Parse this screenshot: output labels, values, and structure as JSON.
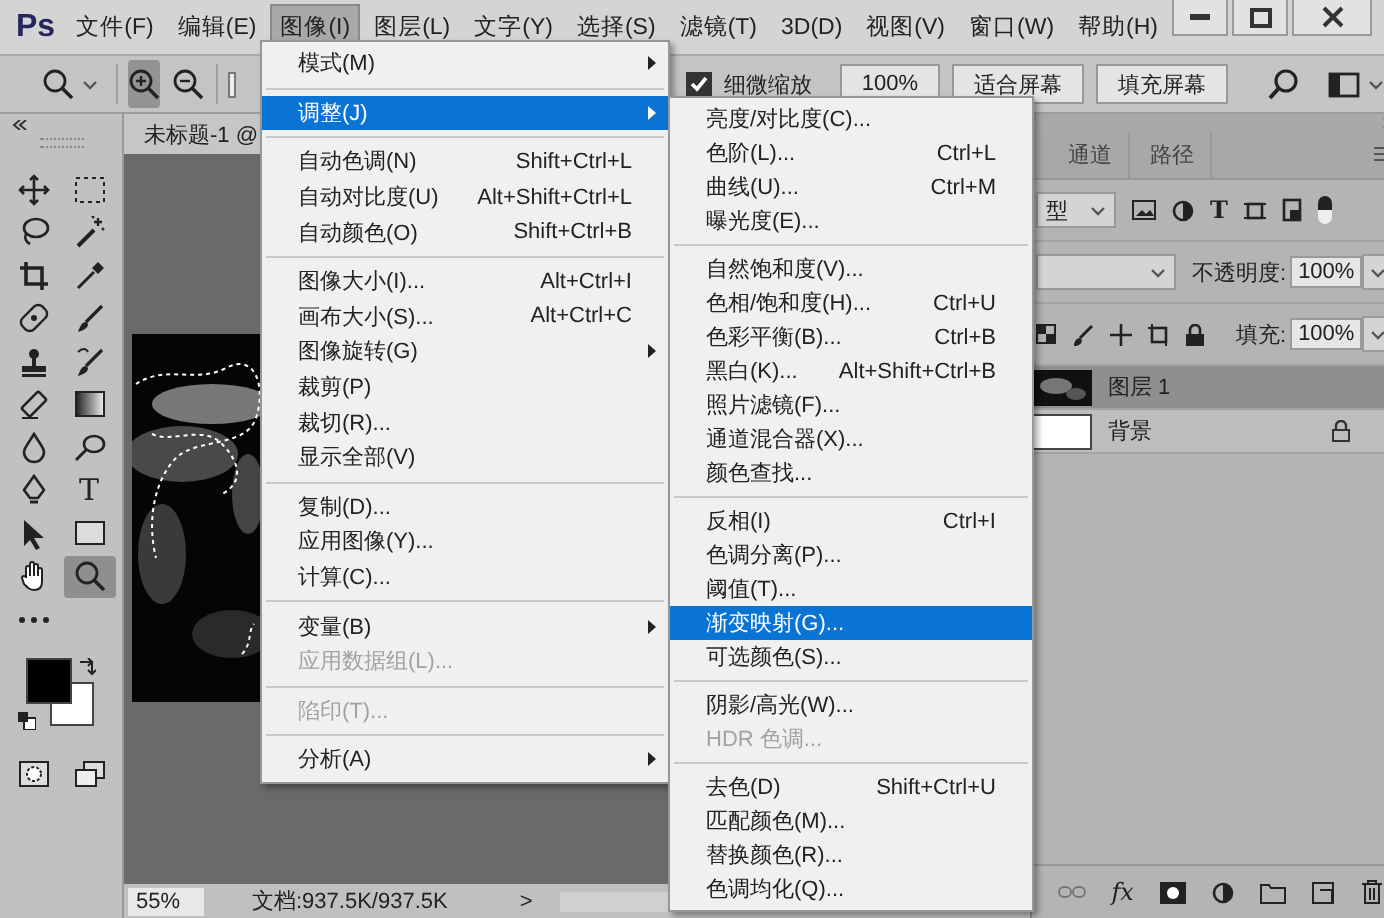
{
  "app": {
    "logo": "Ps"
  },
  "menu_bar": [
    {
      "label": "文件(F)",
      "selected": false
    },
    {
      "label": "编辑(E)",
      "selected": false
    },
    {
      "label": "图像(I)",
      "selected": true
    },
    {
      "label": "图层(L)",
      "selected": false
    },
    {
      "label": "文字(Y)",
      "selected": false
    },
    {
      "label": "选择(S)",
      "selected": false
    },
    {
      "label": "滤镜(T)",
      "selected": false
    },
    {
      "label": "3D(D)",
      "selected": false
    },
    {
      "label": "视图(V)",
      "selected": false
    },
    {
      "label": "窗口(W)",
      "selected": false
    },
    {
      "label": "帮助(H)",
      "selected": false
    }
  ],
  "options_bar": {
    "zoom_modes": [
      {
        "selected": true
      },
      {
        "selected": false
      }
    ],
    "resize_windows": {
      "checked": false
    },
    "fine_zoom": {
      "label": "细微缩放",
      "checked": true
    },
    "buttons": [
      "100%",
      "适合屏幕",
      "填充屏幕"
    ]
  },
  "document_tab": {
    "title": "未标题-1 @"
  },
  "tools": [
    {
      "selected": false
    },
    {
      "selected": false
    },
    {
      "selected": false
    },
    {
      "selected": false
    },
    {
      "selected": false
    },
    {
      "selected": false
    },
    {
      "selected": false
    },
    {
      "selected": false
    },
    {
      "selected": false
    },
    {
      "selected": false
    },
    {
      "selected": false
    },
    {
      "selected": false
    },
    {
      "selected": false
    },
    {
      "selected": false
    },
    {
      "selected": false
    },
    {
      "selected": false,
      "glyph": "T"
    },
    {
      "selected": false
    },
    {
      "selected": false
    },
    {
      "selected": false
    },
    {
      "selected": true
    },
    {
      "selected": false
    },
    {
      "selected": false
    },
    {
      "selected": false
    }
  ],
  "swatches": [
    {
      "color": "#000000"
    },
    {
      "color": "#ffffff"
    }
  ],
  "status_bar": {
    "zoom": "55%",
    "document": "文档:937.5K/937.5K",
    "arrow": ">"
  },
  "layers_panel": {
    "tabs": [
      {
        "label": "通道",
        "selected": false
      },
      {
        "label": "路径",
        "selected": false
      }
    ],
    "filter": "型",
    "filter_type_glyph": "T",
    "opacity_label": "不透明度:",
    "opacity": "100%",
    "fill_label": "填充:",
    "fill": "100%",
    "fx": "fx",
    "layers": [
      {
        "name": "图层 1",
        "selected": true,
        "locked": false,
        "kind": "texture"
      },
      {
        "name": "背景",
        "selected": false,
        "locked": true,
        "kind": "white"
      }
    ]
  },
  "image_menu": [
    {
      "kind": "item",
      "label": "模式(M)",
      "submenu": true,
      "selected": false,
      "disabled": false
    },
    {
      "kind": "separator"
    },
    {
      "kind": "item",
      "label": "调整(J)",
      "submenu": true,
      "selected": true,
      "disabled": false
    },
    {
      "kind": "separator"
    },
    {
      "kind": "item",
      "label": "自动色调(N)",
      "shortcut": "Shift+Ctrl+L",
      "submenu": false,
      "selected": false,
      "disabled": false
    },
    {
      "kind": "item",
      "label": "自动对比度(U)",
      "shortcut": "Alt+Shift+Ctrl+L",
      "submenu": false,
      "selected": false,
      "disabled": false
    },
    {
      "kind": "item",
      "label": "自动颜色(O)",
      "shortcut": "Shift+Ctrl+B",
      "submenu": false,
      "selected": false,
      "disabled": false
    },
    {
      "kind": "separator"
    },
    {
      "kind": "item",
      "label": "图像大小(I)...",
      "shortcut": "Alt+Ctrl+I",
      "submenu": false,
      "selected": false,
      "disabled": false
    },
    {
      "kind": "item",
      "label": "画布大小(S)...",
      "shortcut": "Alt+Ctrl+C",
      "submenu": false,
      "selected": false,
      "disabled": false
    },
    {
      "kind": "item",
      "label": "图像旋转(G)",
      "submenu": true,
      "selected": false,
      "disabled": false
    },
    {
      "kind": "item",
      "label": "裁剪(P)",
      "submenu": false,
      "selected": false,
      "disabled": false
    },
    {
      "kind": "item",
      "label": "裁切(R)...",
      "submenu": false,
      "selected": false,
      "disabled": false
    },
    {
      "kind": "item",
      "label": "显示全部(V)",
      "submenu": false,
      "selected": false,
      "disabled": false
    },
    {
      "kind": "separator"
    },
    {
      "kind": "item",
      "label": "复制(D)...",
      "submenu": false,
      "selected": false,
      "disabled": false
    },
    {
      "kind": "item",
      "label": "应用图像(Y)...",
      "submenu": false,
      "selected": false,
      "disabled": false
    },
    {
      "kind": "item",
      "label": "计算(C)...",
      "submenu": false,
      "selected": false,
      "disabled": false
    },
    {
      "kind": "separator"
    },
    {
      "kind": "item",
      "label": "变量(B)",
      "submenu": true,
      "selected": false,
      "disabled": false
    },
    {
      "kind": "item",
      "label": "应用数据组(L)...",
      "submenu": false,
      "selected": false,
      "disabled": true
    },
    {
      "kind": "separator"
    },
    {
      "kind": "item",
      "label": "陷印(T)...",
      "submenu": false,
      "selected": false,
      "disabled": true
    },
    {
      "kind": "separator"
    },
    {
      "kind": "item",
      "label": "分析(A)",
      "submenu": true,
      "selected": false,
      "disabled": false
    }
  ],
  "adjustments_submenu": [
    {
      "kind": "item",
      "label": "亮度/对比度(C)...",
      "selected": false,
      "disabled": false
    },
    {
      "kind": "item",
      "label": "色阶(L)...",
      "shortcut": "Ctrl+L",
      "selected": false,
      "disabled": false
    },
    {
      "kind": "item",
      "label": "曲线(U)...",
      "shortcut": "Ctrl+M",
      "selected": false,
      "disabled": false
    },
    {
      "kind": "item",
      "label": "曝光度(E)...",
      "selected": false,
      "disabled": false
    },
    {
      "kind": "separator"
    },
    {
      "kind": "item",
      "label": "自然饱和度(V)...",
      "selected": false,
      "disabled": false
    },
    {
      "kind": "item",
      "label": "色相/饱和度(H)...",
      "shortcut": "Ctrl+U",
      "selected": false,
      "disabled": false
    },
    {
      "kind": "item",
      "label": "色彩平衡(B)...",
      "shortcut": "Ctrl+B",
      "selected": false,
      "disabled": false
    },
    {
      "kind": "item",
      "label": "黑白(K)...",
      "shortcut": "Alt+Shift+Ctrl+B",
      "selected": false,
      "disabled": false
    },
    {
      "kind": "item",
      "label": "照片滤镜(F)...",
      "selected": false,
      "disabled": false
    },
    {
      "kind": "item",
      "label": "通道混合器(X)...",
      "selected": false,
      "disabled": false
    },
    {
      "kind": "item",
      "label": "颜色查找...",
      "selected": false,
      "disabled": false
    },
    {
      "kind": "separator"
    },
    {
      "kind": "item",
      "label": "反相(I)",
      "shortcut": "Ctrl+I",
      "selected": false,
      "disabled": false
    },
    {
      "kind": "item",
      "label": "色调分离(P)...",
      "selected": false,
      "disabled": false
    },
    {
      "kind": "item",
      "label": "阈值(T)...",
      "selected": false,
      "disabled": false
    },
    {
      "kind": "item",
      "label": "渐变映射(G)...",
      "selected": true,
      "disabled": false
    },
    {
      "kind": "item",
      "label": "可选颜色(S)...",
      "selected": false,
      "disabled": false
    },
    {
      "kind": "separator"
    },
    {
      "kind": "item",
      "label": "阴影/高光(W)...",
      "selected": false,
      "disabled": false
    },
    {
      "kind": "item",
      "label": "HDR 色调...",
      "selected": false,
      "disabled": true
    },
    {
      "kind": "separator"
    },
    {
      "kind": "item",
      "label": "去色(D)",
      "shortcut": "Shift+Ctrl+U",
      "selected": false,
      "disabled": false
    },
    {
      "kind": "item",
      "label": "匹配颜色(M)...",
      "selected": false,
      "disabled": false
    },
    {
      "kind": "item",
      "label": "替换颜色(R)...",
      "selected": false,
      "disabled": false
    },
    {
      "kind": "item",
      "label": "色调均化(Q)...",
      "selected": false,
      "disabled": false
    }
  ]
}
